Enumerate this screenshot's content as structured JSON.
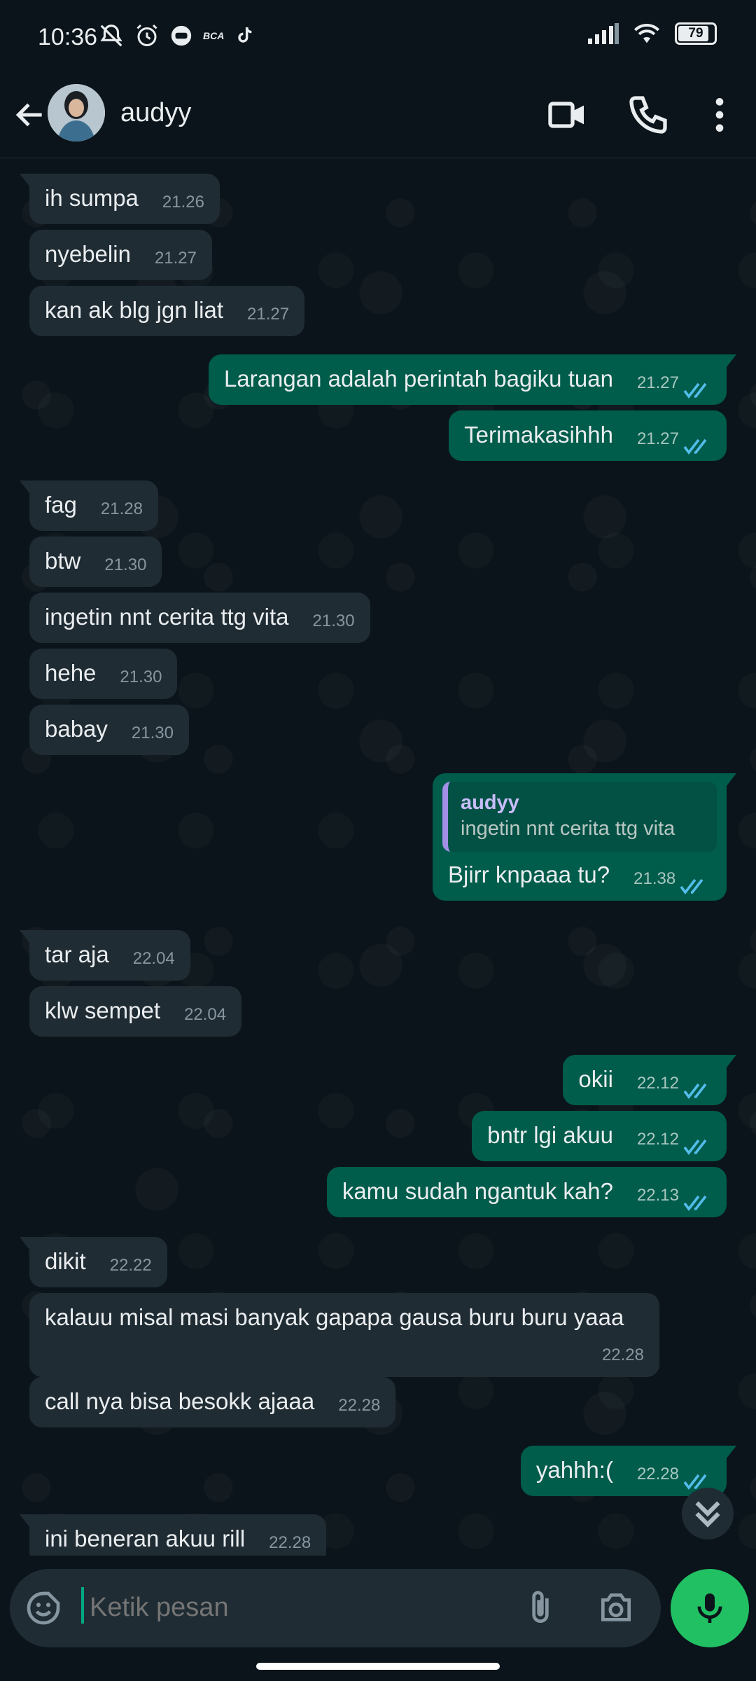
{
  "status_bar": {
    "time": "10:36",
    "battery": "79",
    "bca_label": "BCA"
  },
  "header": {
    "contact_name": "audyy"
  },
  "messages": [
    {
      "dir": "in",
      "text": "ih sumpa",
      "time": "21.26"
    },
    {
      "dir": "in",
      "text": "nyebelin",
      "time": "21.27"
    },
    {
      "dir": "in",
      "text": "kan ak blg jgn liat",
      "time": "21.27"
    },
    {
      "dir": "out",
      "text": "Larangan adalah perintah bagiku tuan",
      "time": "21.27"
    },
    {
      "dir": "out",
      "text": "Terimakasihhh",
      "time": "21.27"
    },
    {
      "dir": "in",
      "text": "fag",
      "time": "21.28"
    },
    {
      "dir": "in",
      "text": "btw",
      "time": "21.30"
    },
    {
      "dir": "in",
      "text": "ingetin nnt cerita ttg vita",
      "time": "21.30"
    },
    {
      "dir": "in",
      "text": "hehe",
      "time": "21.30"
    },
    {
      "dir": "in",
      "text": "babay",
      "time": "21.30"
    },
    {
      "dir": "out",
      "text": "Bjirr knpaaa tu?",
      "time": "21.38",
      "reply_name": "audyy",
      "reply_text": "ingetin nnt cerita ttg vita"
    },
    {
      "dir": "in",
      "text": "tar aja",
      "time": "22.04"
    },
    {
      "dir": "in",
      "text": "klw sempet",
      "time": "22.04"
    },
    {
      "dir": "out",
      "text": "okii",
      "time": "22.12"
    },
    {
      "dir": "out",
      "text": "bntr lgi akuu",
      "time": "22.12"
    },
    {
      "dir": "out",
      "text": "kamu sudah ngantuk kah?",
      "time": "22.13"
    },
    {
      "dir": "in",
      "text": "dikit",
      "time": "22.22"
    },
    {
      "dir": "in",
      "text": "kalauu misal masi banyak gapapa gausa buru buru yaaa",
      "time": "22.28"
    },
    {
      "dir": "in",
      "text": "call nya bisa besokk ajaaa",
      "time": "22.28"
    },
    {
      "dir": "out",
      "text": "yahhh:(",
      "time": "22.28"
    },
    {
      "dir": "in",
      "text": "ini beneran akuu rill",
      "time": "22.28"
    }
  ],
  "input": {
    "placeholder": "Ketik pesan"
  },
  "icons": {
    "back": "arrow-left-icon",
    "video": "video-call-icon",
    "call": "phone-icon",
    "menu": "more-vertical-icon",
    "emoji": "sticker-icon",
    "attach": "paperclip-icon",
    "camera": "camera-icon",
    "mic": "microphone-icon",
    "scroll": "double-chevron-down-icon",
    "read": "double-check-icon"
  },
  "colors": {
    "background": "#0b141a",
    "incoming": "#202c33",
    "outgoing": "#005c4b",
    "read_ticks": "#53bdeb",
    "accent": "#21c063",
    "reply_bar": "#a190e6"
  }
}
